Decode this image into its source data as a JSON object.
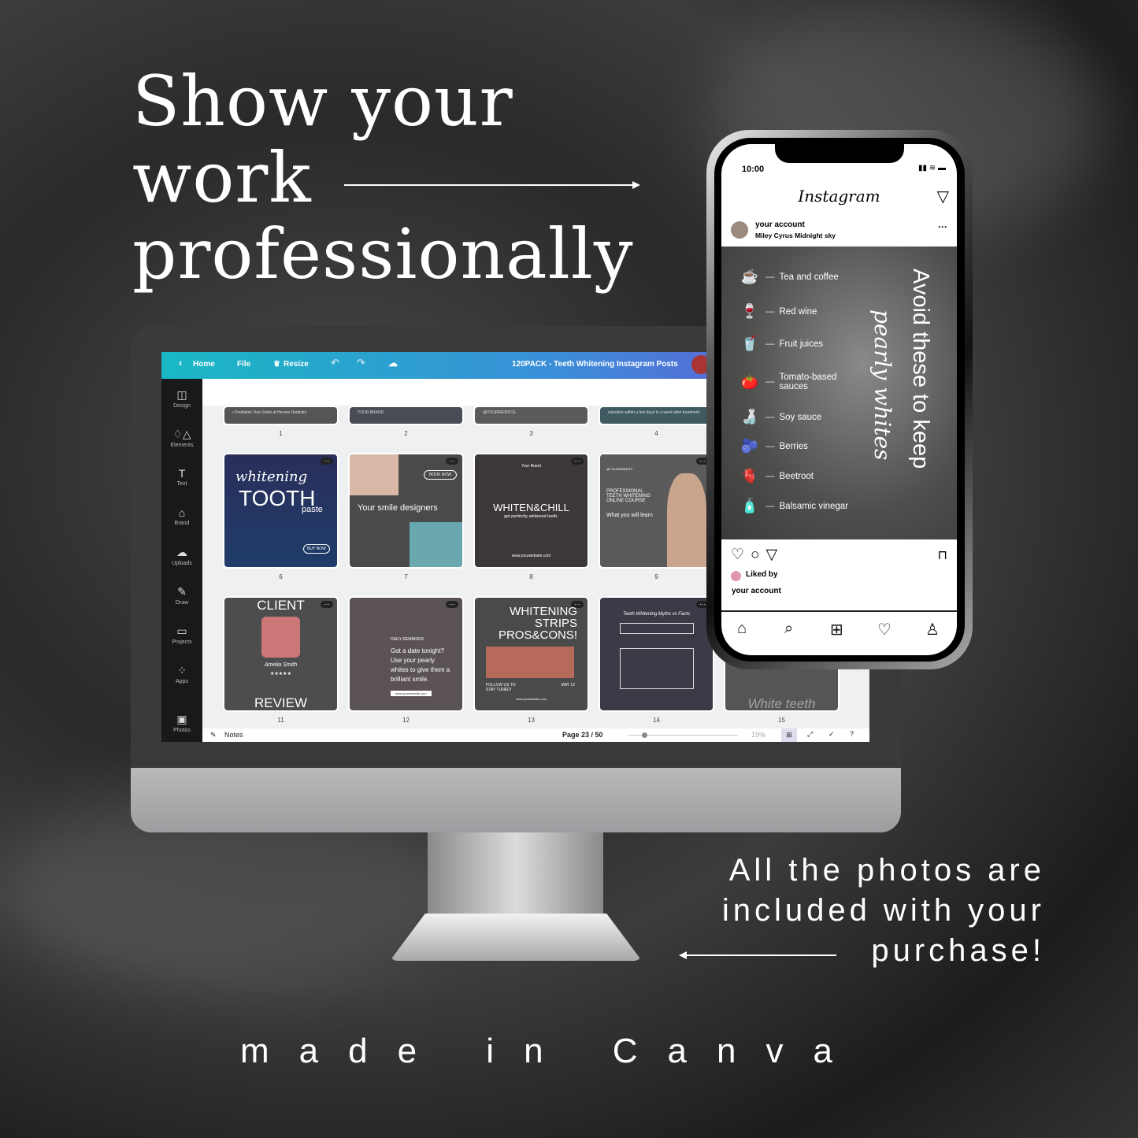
{
  "headline": {
    "line1": "Show your",
    "line2": "work",
    "line3": "professionally"
  },
  "side_text": {
    "line1": "All the photos are",
    "line2": "included with your",
    "line3": "purchase!"
  },
  "footer": "made in Canva",
  "canva": {
    "topbar": {
      "back_icon": "chevron-left-icon",
      "home": "Home",
      "file": "File",
      "resize": "Resize",
      "title": "120PACK - Teeth Whitening Instagram Posts"
    },
    "sidebar": [
      {
        "label": "Design",
        "icon": "◫"
      },
      {
        "label": "Elements",
        "icon": "♢△"
      },
      {
        "label": "Text",
        "icon": "T"
      },
      {
        "label": "Brand",
        "icon": "⌂"
      },
      {
        "label": "Uploads",
        "icon": "☁"
      },
      {
        "label": "Draw",
        "icon": "✎"
      },
      {
        "label": "Projects",
        "icon": "▭"
      },
      {
        "label": "Apps",
        "icon": "⁘"
      },
      {
        "label": "Photos",
        "icon": "▣"
      }
    ],
    "row1": [
      {
        "num": "1",
        "text": "• Revitalize Your Smile at Heroes Dentistry"
      },
      {
        "num": "2",
        "text": "YOUR BRAND"
      },
      {
        "num": "3",
        "text": "@YOURWEBSITE"
      },
      {
        "num": "4",
        "text": "subsides within a few days to a week after treatment."
      }
    ],
    "row2": [
      {
        "num": "6",
        "script": "whitening",
        "title": "TOOTH",
        "sub": "paste",
        "button": "BUY NOW"
      },
      {
        "num": "7",
        "title": "Your smile designers",
        "button": "BOOK NOW"
      },
      {
        "num": "8",
        "brand": "Your Brand",
        "title": "WHITEN&CHILL",
        "sub": "get perfectly whitened teeth.",
        "url": "www.yourwebsite.com"
      },
      {
        "num": "9",
        "brand": "@YOURWEBSITE",
        "title": "PROFESSIONAL TEETH WHITENING ONLINE COURSE",
        "sub": "What you will learn"
      }
    ],
    "row3": [
      {
        "num": "11",
        "title": "CLIENT",
        "name": "Amelia Smith",
        "stars": "★★★★★",
        "bottom": "REVIEW"
      },
      {
        "num": "12",
        "label": "DAILY REMINDER",
        "title": "Got a date tonight? Use your pearly whites to give them a brilliant smile.",
        "url": "www.yourwebsite.com"
      },
      {
        "num": "13",
        "title": "WHITENING STRIPS PROS&CONS!",
        "follow": "FOLLOW US TO STAY TUNED!",
        "date": "MAY 12",
        "url": "www.yourwebsite.com"
      },
      {
        "num": "14",
        "title": "Teeth Whitening Myths vs Facts"
      },
      {
        "num": "15",
        "title": "White teeth"
      }
    ],
    "bottombar": {
      "notes": "Notes",
      "page": "Page 23 / 50",
      "zoom": "19%",
      "zoom_value": 19
    }
  },
  "instagram": {
    "time": "10:00",
    "logo": "Instagram",
    "account": "your account",
    "song": "Miley Cyrus   Midnight sky",
    "post_title": "Avoid these to keep",
    "post_script": "pearly whites",
    "items": [
      {
        "icon": "☕",
        "label": "Tea and coffee"
      },
      {
        "icon": "🍷",
        "label": "Red wine"
      },
      {
        "icon": "🥤",
        "label": "Fruit juices"
      },
      {
        "icon": "🍅",
        "label": "Tomato-based sauces"
      },
      {
        "icon": "🍶",
        "label": "Soy sauce"
      },
      {
        "icon": "🫐",
        "label": "Berries"
      },
      {
        "icon": "🫀",
        "label": "Beetroot"
      },
      {
        "icon": "🧴",
        "label": "Balsamic vinegar"
      }
    ],
    "liked_by": "Liked by",
    "liked_account": "your account"
  }
}
